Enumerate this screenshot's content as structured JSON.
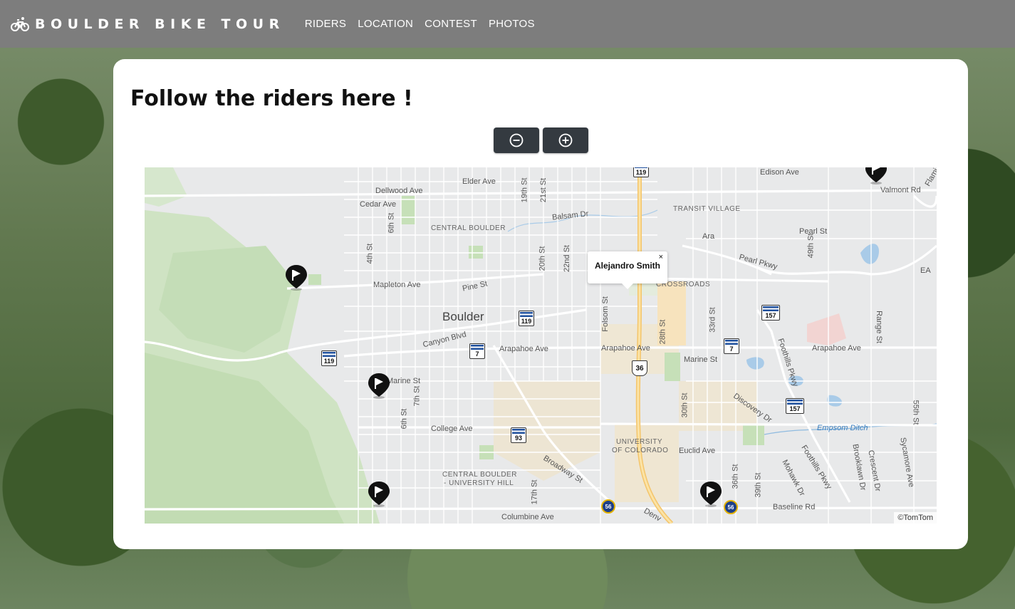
{
  "navbar": {
    "brand_icon": "bicycle-icon",
    "brand": "BOULDER BIKE TOUR",
    "links": [
      "RIDERS",
      "LOCATION",
      "CONTEST",
      "PHOTOS"
    ]
  },
  "main": {
    "title": "Follow the riders here !",
    "zoom_out_icon": "zoom-out-icon",
    "zoom_in_icon": "zoom-in-icon"
  },
  "map": {
    "marker_icon": "flag-marker-icon",
    "popup": {
      "name": "Alejandro Smith",
      "close": "×"
    },
    "attribution": "©TomTom",
    "labels": {
      "city": "Boulder",
      "central_boulder": "CENTRAL BOULDER",
      "transit_village": "TRANSIT VILLAGE",
      "crossroads": "CROSSROADS",
      "university_1": "UNIVERSITY",
      "university_2": "OF COLORADO",
      "cb_university_hill_1": "CENTRAL BOULDER",
      "cb_university_hill_2": "- UNIVERSITY HILL",
      "ara": "Ara",
      "elder_ave": "Elder Ave",
      "dellwood_ave": "Dellwood Ave",
      "cedar_ave": "Cedar Ave",
      "balsam_dr": "Balsam Dr",
      "edison_ave": "Edison Ave",
      "valmont_rd": "Valmont Rd",
      "pearl_st": "Pearl St",
      "pearl_pkwy": "Pearl Pkwy",
      "mapleton_ave": "Mapleton Ave",
      "pine_st": "Pine St",
      "canyon_blvd": "Canyon Blvd",
      "arapahoe_1": "Arapahoe Ave",
      "arapahoe_2": "Arapahoe Ave",
      "arapahoe_3": "Arapahoe Ave",
      "marine_st_1": "Marine St",
      "marine_st_2": "Marine St",
      "college_ave": "College Ave",
      "broadway_st": "Broadway St",
      "euclid_ave": "Euclid Ave",
      "baseline_rd": "Baseline Rd",
      "columbine_ave": "Columbine Ave",
      "empsom_ditch": "Empsom Ditch",
      "discovery_dr": "Discovery Dr",
      "foothills_pkwy_1": "Foothills Pkwy",
      "foothills_pkwy_2": "Foothills Pkwy",
      "mohawk_dr": "Mohawk Dr",
      "brooklawn_dr": "Brooklawn Dr",
      "crescent_dr": "Crescent Dr",
      "sycamore_ave": "Sycamore Ave",
      "range_st": "Range St",
      "st_55th": "55th St",
      "st_49th": "49th St",
      "st_39th": "39th St",
      "st_36th": "36th St",
      "st_33rd": "33rd St",
      "st_30th": "30th St",
      "st_28th": "28th St",
      "st_22nd": "22nd St",
      "st_21st": "21st St",
      "st_20th": "20th St",
      "st_19th": "19th St",
      "st_17th": "17th St",
      "st_7th": "7th St",
      "st_6th_1": "6th St",
      "st_6th_2": "6th St",
      "st_4th": "4th St",
      "folsom_st": "Folsom St",
      "ea": "EA",
      "flam": "Flami",
      "denver": "Denv"
    },
    "shields": {
      "co119_a": "119",
      "co119_b": "119",
      "co119_c": "119",
      "co7_a": "7",
      "co7_b": "7",
      "co93": "93",
      "co157_a": "157",
      "co157_b": "157",
      "us36": "36",
      "co56_a": "56",
      "co56_b": "56"
    }
  }
}
